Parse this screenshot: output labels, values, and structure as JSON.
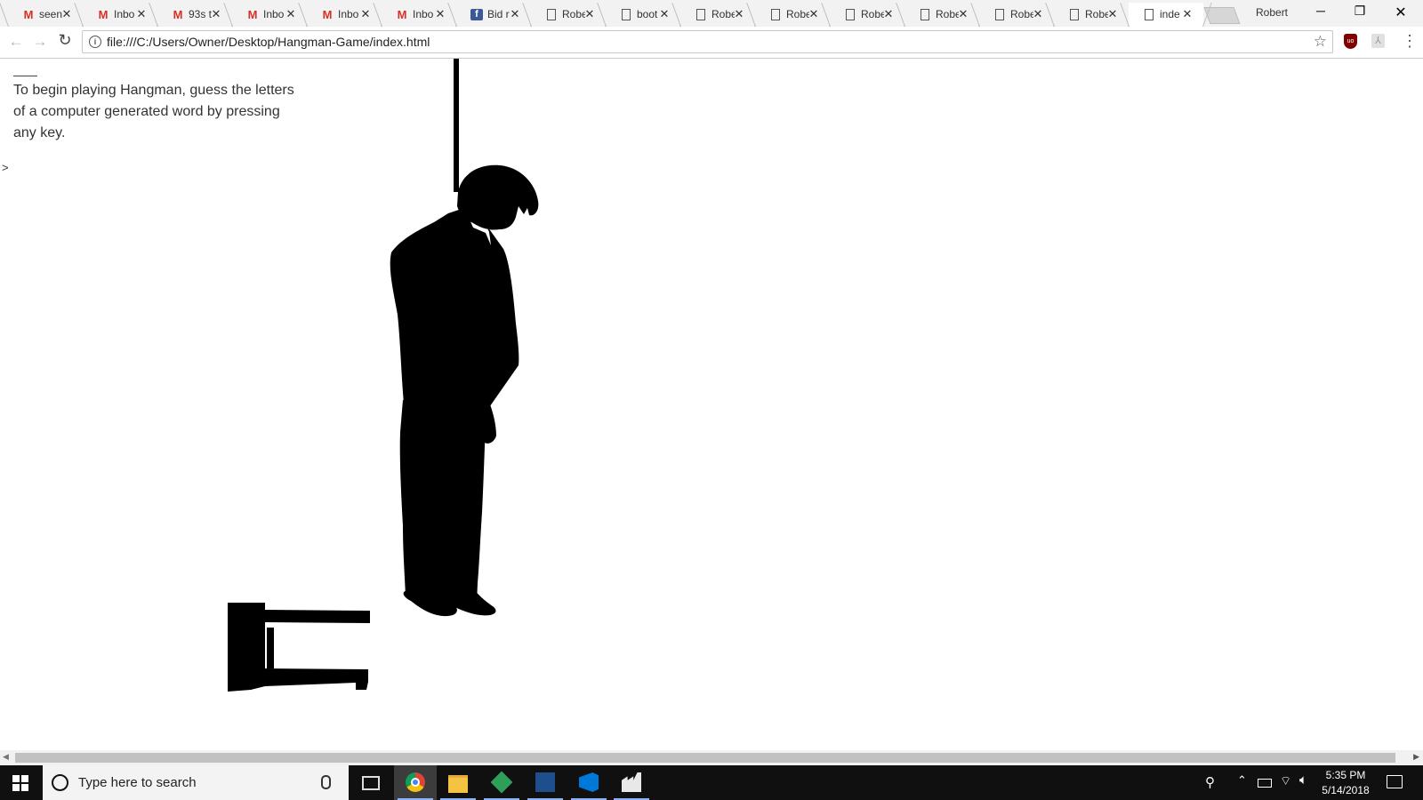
{
  "browser": {
    "tabs": [
      {
        "title": "seen",
        "favicon": "gmail-icon"
      },
      {
        "title": "Inbo",
        "favicon": "gmail-icon"
      },
      {
        "title": "93s t",
        "favicon": "gmail-icon"
      },
      {
        "title": "Inbo",
        "favicon": "gmail-icon"
      },
      {
        "title": "Inbo",
        "favicon": "gmail-icon"
      },
      {
        "title": "Inbo",
        "favicon": "gmail-icon"
      },
      {
        "title": "Bid r",
        "favicon": "facebook-icon"
      },
      {
        "title": "Robe",
        "favicon": "document-icon"
      },
      {
        "title": "boot",
        "favicon": "document-icon"
      },
      {
        "title": "Robe",
        "favicon": "document-icon"
      },
      {
        "title": "Robe",
        "favicon": "document-icon"
      },
      {
        "title": "Robe",
        "favicon": "document-icon"
      },
      {
        "title": "Robe",
        "favicon": "document-icon"
      },
      {
        "title": "Robe",
        "favicon": "document-icon"
      },
      {
        "title": "Robe",
        "favicon": "document-icon"
      },
      {
        "title": "inde",
        "favicon": "document-icon",
        "active": true
      }
    ],
    "profile_name": "Robert",
    "url": "file:///C:/Users/Owner/Desktop/Hangman-Game/index.html",
    "colors": {
      "gmail": "#d93025",
      "facebook": "#3b5998",
      "ublock": "#800000"
    }
  },
  "page": {
    "instructions": "To begin playing Hangman, guess the letters of a computer generated word by pressing any key.",
    "prompt": ">"
  },
  "taskbar": {
    "search_placeholder": "Type here to search",
    "apps": [
      "chrome-icon",
      "file-explorer-icon",
      "git-gui-icon",
      "sql-server-management-studio-icon",
      "vscode-icon",
      "factory-icon"
    ],
    "clock_time": "5:35 PM",
    "clock_date": "5/14/2018"
  }
}
